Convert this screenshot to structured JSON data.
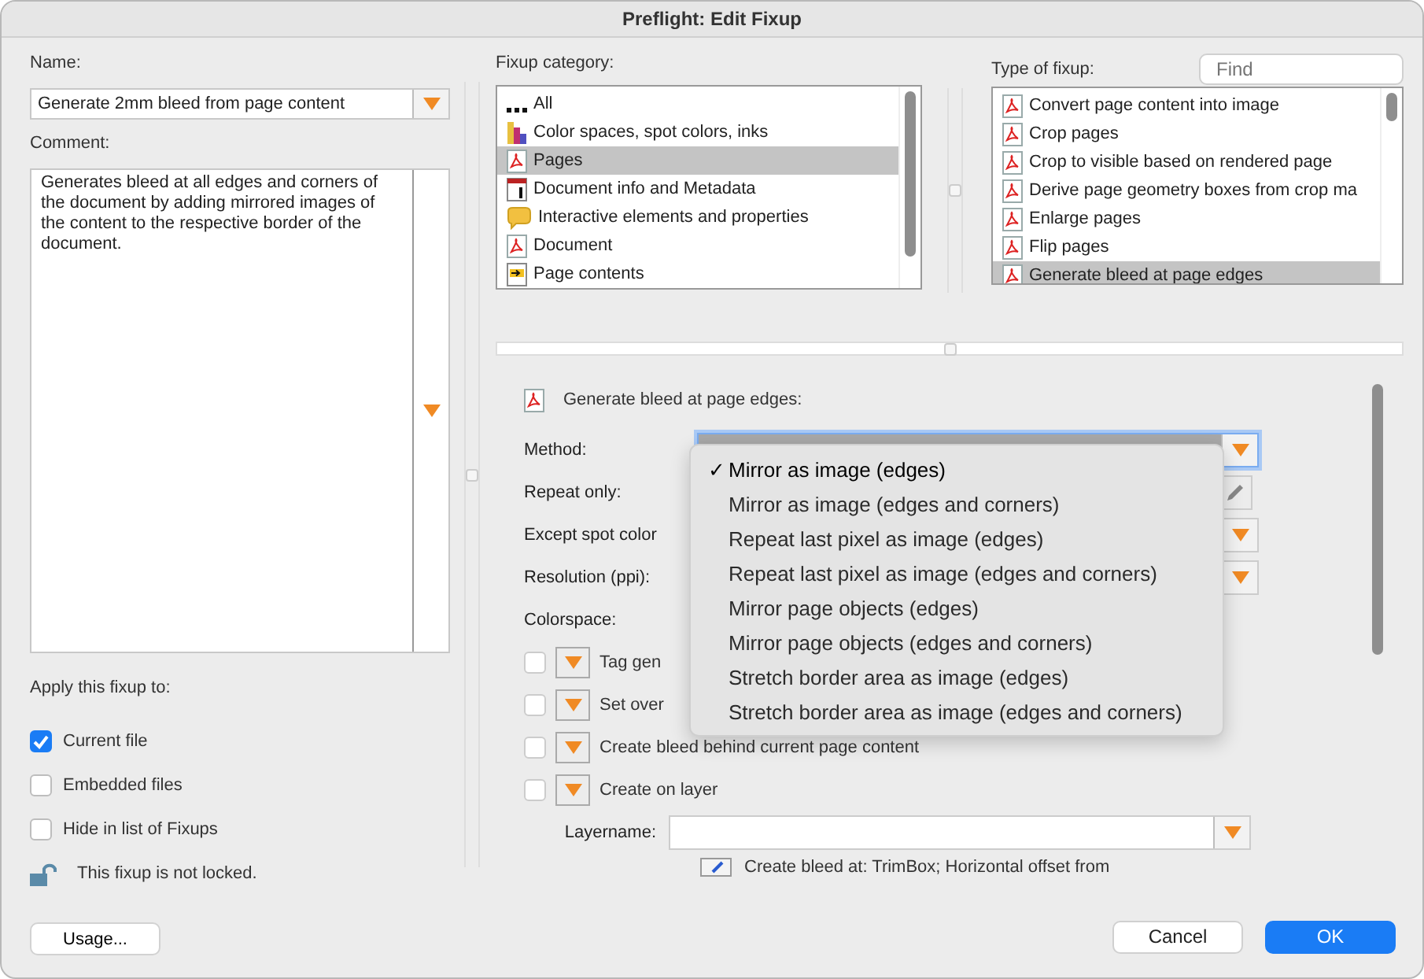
{
  "window": {
    "title": "Preflight: Edit Fixup"
  },
  "name": {
    "label": "Name:",
    "value": "Generate 2mm bleed from page content"
  },
  "comment": {
    "label": "Comment:",
    "value": "Generates bleed at all edges and corners of the document by adding mirrored images of the content to the respective border of the document."
  },
  "apply": {
    "label": "Apply this fixup to:",
    "options": [
      {
        "label": "Current file",
        "checked": true
      },
      {
        "label": "Embedded files",
        "checked": false
      },
      {
        "label": "Hide in list of Fixups",
        "checked": false
      }
    ]
  },
  "lock": {
    "text": "This fixup is not locked.",
    "locked": false
  },
  "usage_button": "Usage...",
  "category": {
    "label": "Fixup category:",
    "items": [
      {
        "label": "All",
        "kind": "dots",
        "selected": false
      },
      {
        "label": "Color spaces, spot colors, inks",
        "kind": "swatch",
        "selected": false
      },
      {
        "label": "Pages",
        "kind": "pdf",
        "selected": true
      },
      {
        "label": "Document info and Metadata",
        "kind": "info",
        "selected": false
      },
      {
        "label": "Interactive elements and properties",
        "kind": "comment",
        "selected": false
      },
      {
        "label": "Document",
        "kind": "pdf",
        "selected": false
      },
      {
        "label": "Page contents",
        "kind": "page",
        "selected": false
      }
    ]
  },
  "type": {
    "label": "Type of fixup:",
    "search": {
      "placeholder": "Find"
    },
    "items": [
      {
        "label": "Convert page content into image",
        "selected": false
      },
      {
        "label": "Crop pages",
        "selected": false
      },
      {
        "label": "Crop to visible based on rendered page",
        "selected": false
      },
      {
        "label": "Derive page geometry boxes from crop ma",
        "selected": false
      },
      {
        "label": "Enlarge pages",
        "selected": false
      },
      {
        "label": "Flip pages",
        "selected": false
      },
      {
        "label": "Generate bleed at page edges",
        "selected": true
      }
    ]
  },
  "details": {
    "title": "Generate bleed at page edges:",
    "method": {
      "label": "Method:",
      "focused": true
    },
    "fields": [
      {
        "kind": "edit",
        "label": "Repeat only:"
      },
      {
        "kind": "select",
        "label": "Except spot color"
      },
      {
        "kind": "select",
        "label": "Resolution (ppi):"
      },
      {
        "kind": "short",
        "label": "Colorspace:"
      }
    ],
    "checks": [
      {
        "label": "Tag gen",
        "checked": false
      },
      {
        "label": "Set over",
        "checked": false
      },
      {
        "label": "Create bleed behind current page content",
        "checked": false
      },
      {
        "label": "Create on layer",
        "checked": false
      }
    ],
    "layername": {
      "label": "Layername:"
    },
    "note": "Create bleed at: TrimBox; Horizontal offset from"
  },
  "method_menu": {
    "check_mark": "✓",
    "items": [
      {
        "label": "Mirror as image (edges)",
        "selected": true
      },
      {
        "label": "Mirror as image (edges and corners)",
        "selected": false
      },
      {
        "label": "Repeat last pixel as image (edges)",
        "selected": false
      },
      {
        "label": "Repeat last pixel as image (edges and corners)",
        "selected": false
      },
      {
        "label": "Mirror page objects (edges)",
        "selected": false
      },
      {
        "label": "Mirror page objects (edges and corners)",
        "selected": false
      },
      {
        "label": "Stretch border area as image (edges)",
        "selected": false
      },
      {
        "label": "Stretch border area as image (edges and corners)",
        "selected": false
      }
    ]
  },
  "buttons": [
    {
      "label": "Cancel",
      "kind": "default"
    },
    {
      "label": "OK",
      "kind": "primary"
    }
  ]
}
